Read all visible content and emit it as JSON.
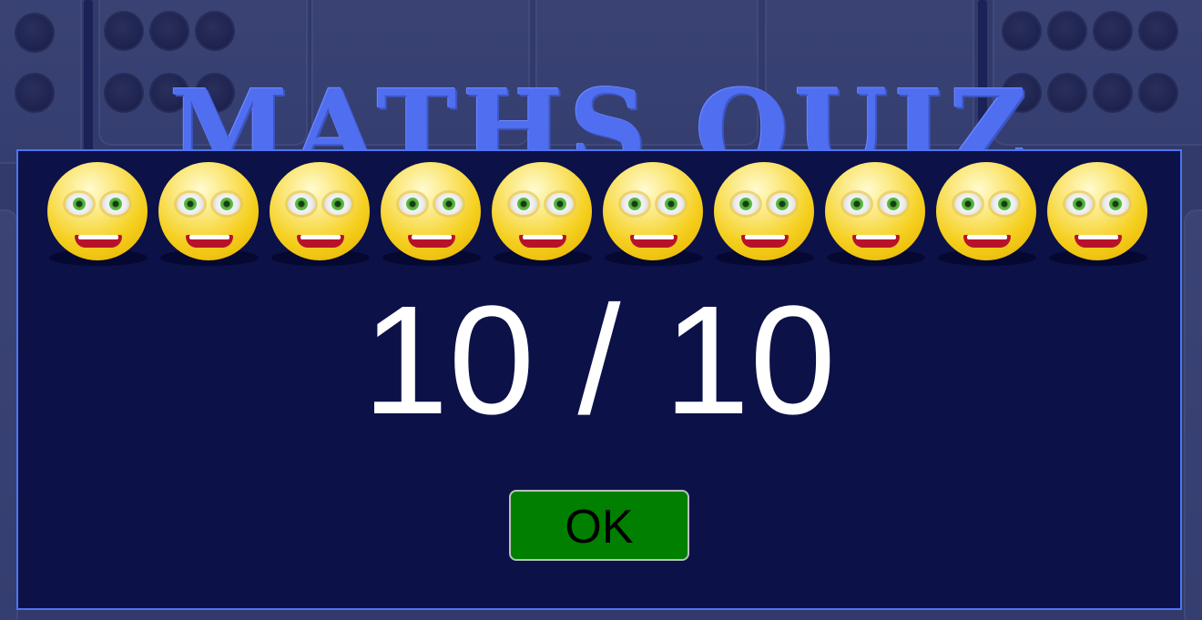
{
  "header": {
    "title": "MATHS QUIZ"
  },
  "result": {
    "faces": [
      "smiley-face",
      "smiley-face",
      "smiley-face",
      "smiley-face",
      "smiley-face",
      "smiley-face",
      "smiley-face",
      "smiley-face",
      "smiley-face",
      "smiley-face"
    ],
    "score_text": "10 / 10",
    "correct": 10,
    "total": 10
  },
  "actions": {
    "ok_label": "OK"
  },
  "colors": {
    "title": "#4f6ef0",
    "panel_bg": "#0c1148",
    "panel_border": "#4f74f2",
    "ok_button": "#007f00",
    "score_text": "#ffffff"
  }
}
